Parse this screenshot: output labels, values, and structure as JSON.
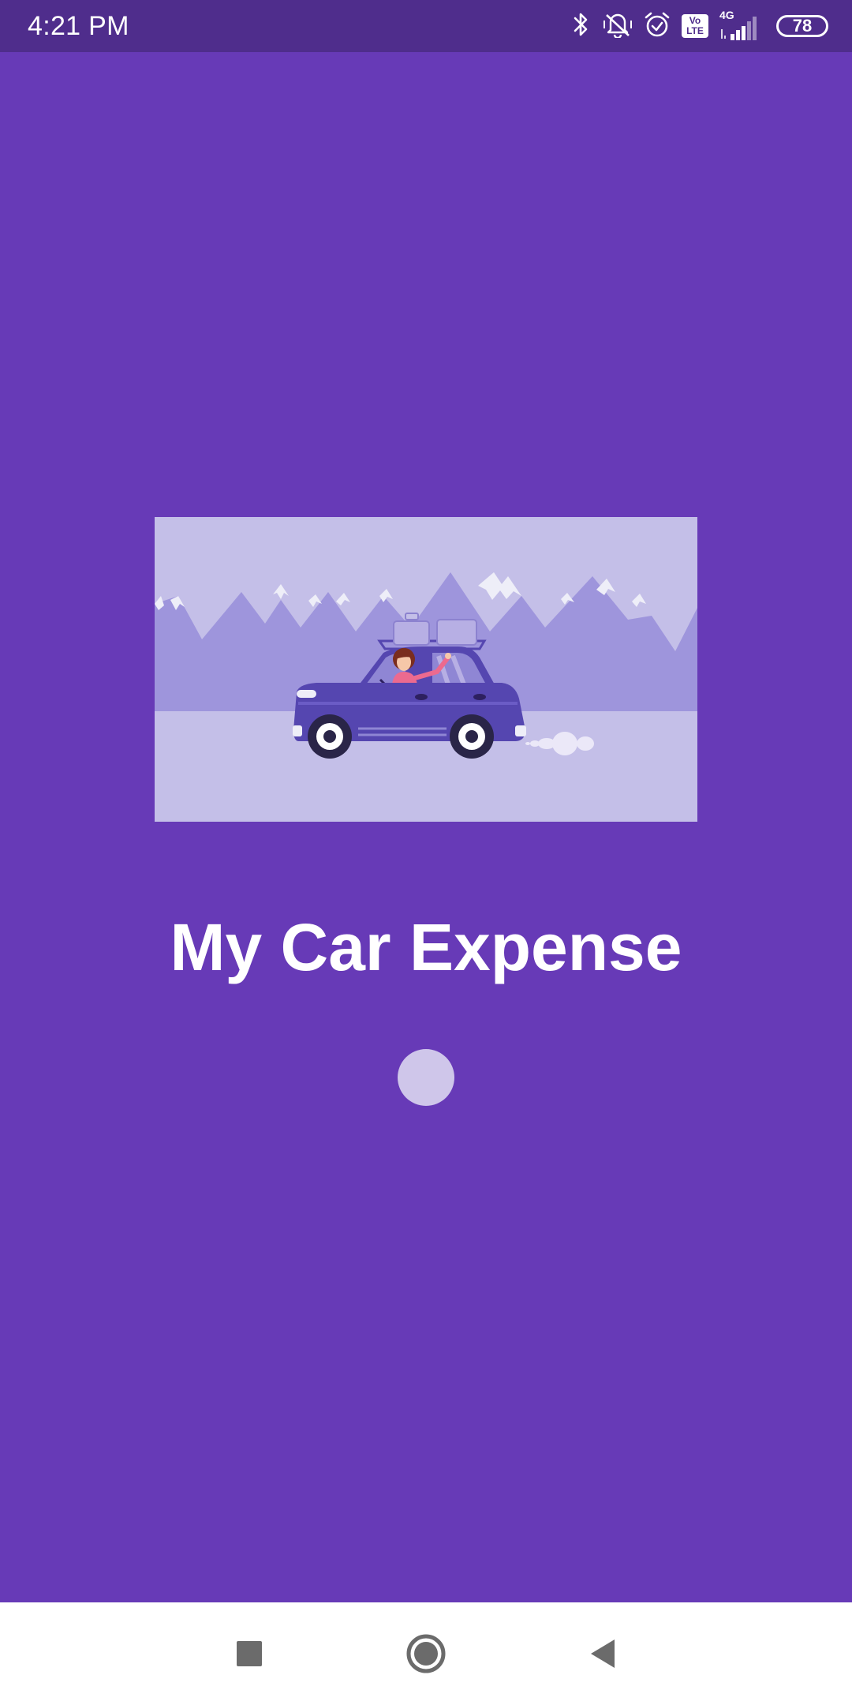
{
  "status_bar": {
    "time": "4:21 PM",
    "network_type": "4G",
    "volte_label_top": "Vo",
    "volte_label_bottom": "LTE",
    "battery_level": "78",
    "icons": [
      "bluetooth-icon",
      "vibrate-icon",
      "alarm-icon",
      "volte-icon",
      "signal-icon",
      "battery-icon"
    ]
  },
  "splash": {
    "app_title": "My Car Expense",
    "illustration": "car-travel-illustration",
    "loading_indicator": "loading-dot"
  },
  "nav_bar": {
    "buttons": [
      "recent-apps-button",
      "home-button",
      "back-button"
    ]
  },
  "colors": {
    "background": "#673ab7",
    "status_bar": "#4f2d8c",
    "illustration_sky": "#c4bfe8",
    "mountains": "#9e95dc",
    "car": "#5546b0",
    "loader": "#cfc6ea",
    "nav_bar": "#ffffff"
  }
}
